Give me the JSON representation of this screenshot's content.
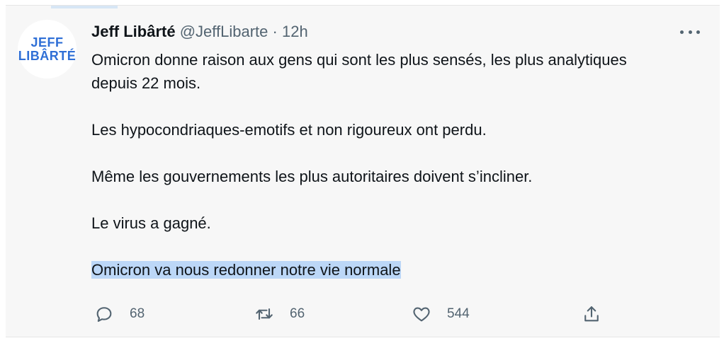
{
  "tweet": {
    "avatar": {
      "line1": "JEFF",
      "line2": "LIBÂRTÉ"
    },
    "author_name": "Jeff Libârté",
    "handle": "@JeffLibarte",
    "separator": "·",
    "time": "12h",
    "paragraphs": [
      "Omicron donne raison aux gens qui sont les plus sensés, les plus analytiques depuis 22 mois.",
      "Les hypocondriaques-emotifs et non rigoureux ont perdu.",
      "Même les gouvernements les plus autoritaires doivent s’incliner.",
      "Le virus a gagné."
    ],
    "highlighted_text": "Omicron va nous redonner notre vie normale",
    "actions": {
      "replies": "68",
      "retweets": "66",
      "likes": "544"
    },
    "icons": {
      "more": "more-horizontal-icon",
      "reply": "reply-icon",
      "retweet": "retweet-icon",
      "like": "heart-icon",
      "share": "share-icon"
    },
    "colors": {
      "avatar_text": "#2f6fd6",
      "secondary_text": "#536471",
      "highlight": "#bcd7f7"
    }
  }
}
